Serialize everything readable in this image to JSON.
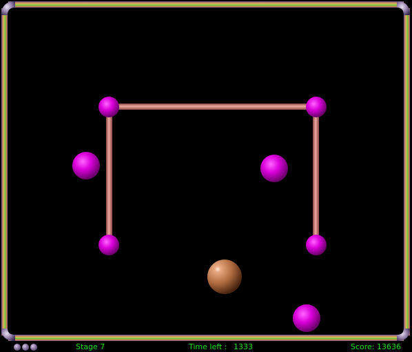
{
  "hud": {
    "stage_label": "Stage 7",
    "time_label": "Time left :",
    "time_value": "1333",
    "score_label": "Score: 13636",
    "lives": 3
  },
  "colors": {
    "background": "#000000",
    "hud_text": "#22dd22",
    "enemy_ball": "#cc00cc",
    "player_ball": "#b87848",
    "wall_pipe": "#d88880"
  },
  "icons": [
    "life-ball-icon"
  ]
}
